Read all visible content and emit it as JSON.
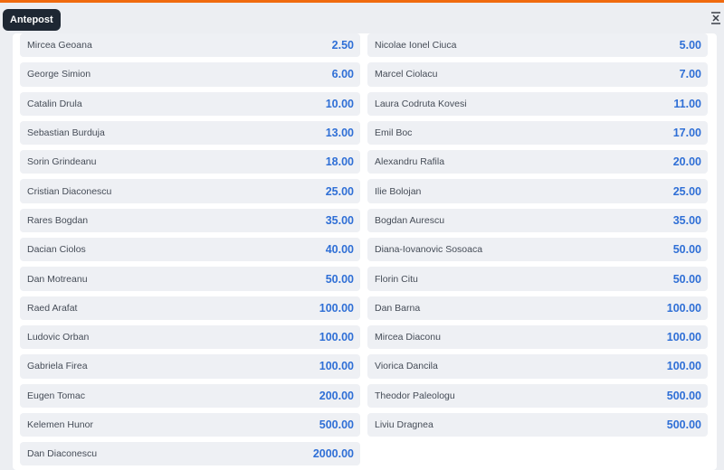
{
  "header": {
    "tab_label": "Antepost",
    "collapse_icon": "collapse-vertical-icon"
  },
  "colors": {
    "accent": "#f06a0f",
    "odds": "#2f6fd6",
    "tab_bg": "#1e2733",
    "row_bg": "#eef0f4"
  },
  "left": [
    {
      "name": "Mircea Geoana",
      "odd": "2.50"
    },
    {
      "name": "George Simion",
      "odd": "6.00"
    },
    {
      "name": "Catalin Drula",
      "odd": "10.00"
    },
    {
      "name": "Sebastian Burduja",
      "odd": "13.00"
    },
    {
      "name": "Sorin Grindeanu",
      "odd": "18.00"
    },
    {
      "name": "Cristian Diaconescu",
      "odd": "25.00"
    },
    {
      "name": "Rares Bogdan",
      "odd": "35.00"
    },
    {
      "name": "Dacian Ciolos",
      "odd": "40.00"
    },
    {
      "name": "Dan Motreanu",
      "odd": "50.00"
    },
    {
      "name": "Raed Arafat",
      "odd": "100.00"
    },
    {
      "name": "Ludovic Orban",
      "odd": "100.00"
    },
    {
      "name": "Gabriela Firea",
      "odd": "100.00"
    },
    {
      "name": "Eugen Tomac",
      "odd": "200.00"
    },
    {
      "name": "Kelemen Hunor",
      "odd": "500.00"
    },
    {
      "name": "Dan Diaconescu",
      "odd": "2000.00"
    }
  ],
  "right": [
    {
      "name": "Nicolae Ionel Ciuca",
      "odd": "5.00"
    },
    {
      "name": "Marcel Ciolacu",
      "odd": "7.00"
    },
    {
      "name": "Laura Codruta Kovesi",
      "odd": "11.00"
    },
    {
      "name": "Emil Boc",
      "odd": "17.00"
    },
    {
      "name": "Alexandru Rafila",
      "odd": "20.00"
    },
    {
      "name": "Ilie Bolojan",
      "odd": "25.00"
    },
    {
      "name": "Bogdan Aurescu",
      "odd": "35.00"
    },
    {
      "name": "Diana-Iovanovic Sosoaca",
      "odd": "50.00"
    },
    {
      "name": "Florin Citu",
      "odd": "50.00"
    },
    {
      "name": "Dan Barna",
      "odd": "100.00"
    },
    {
      "name": "Mircea Diaconu",
      "odd": "100.00"
    },
    {
      "name": "Viorica Dancila",
      "odd": "100.00"
    },
    {
      "name": "Theodor Paleologu",
      "odd": "500.00"
    },
    {
      "name": "Liviu Dragnea",
      "odd": "500.00"
    }
  ]
}
